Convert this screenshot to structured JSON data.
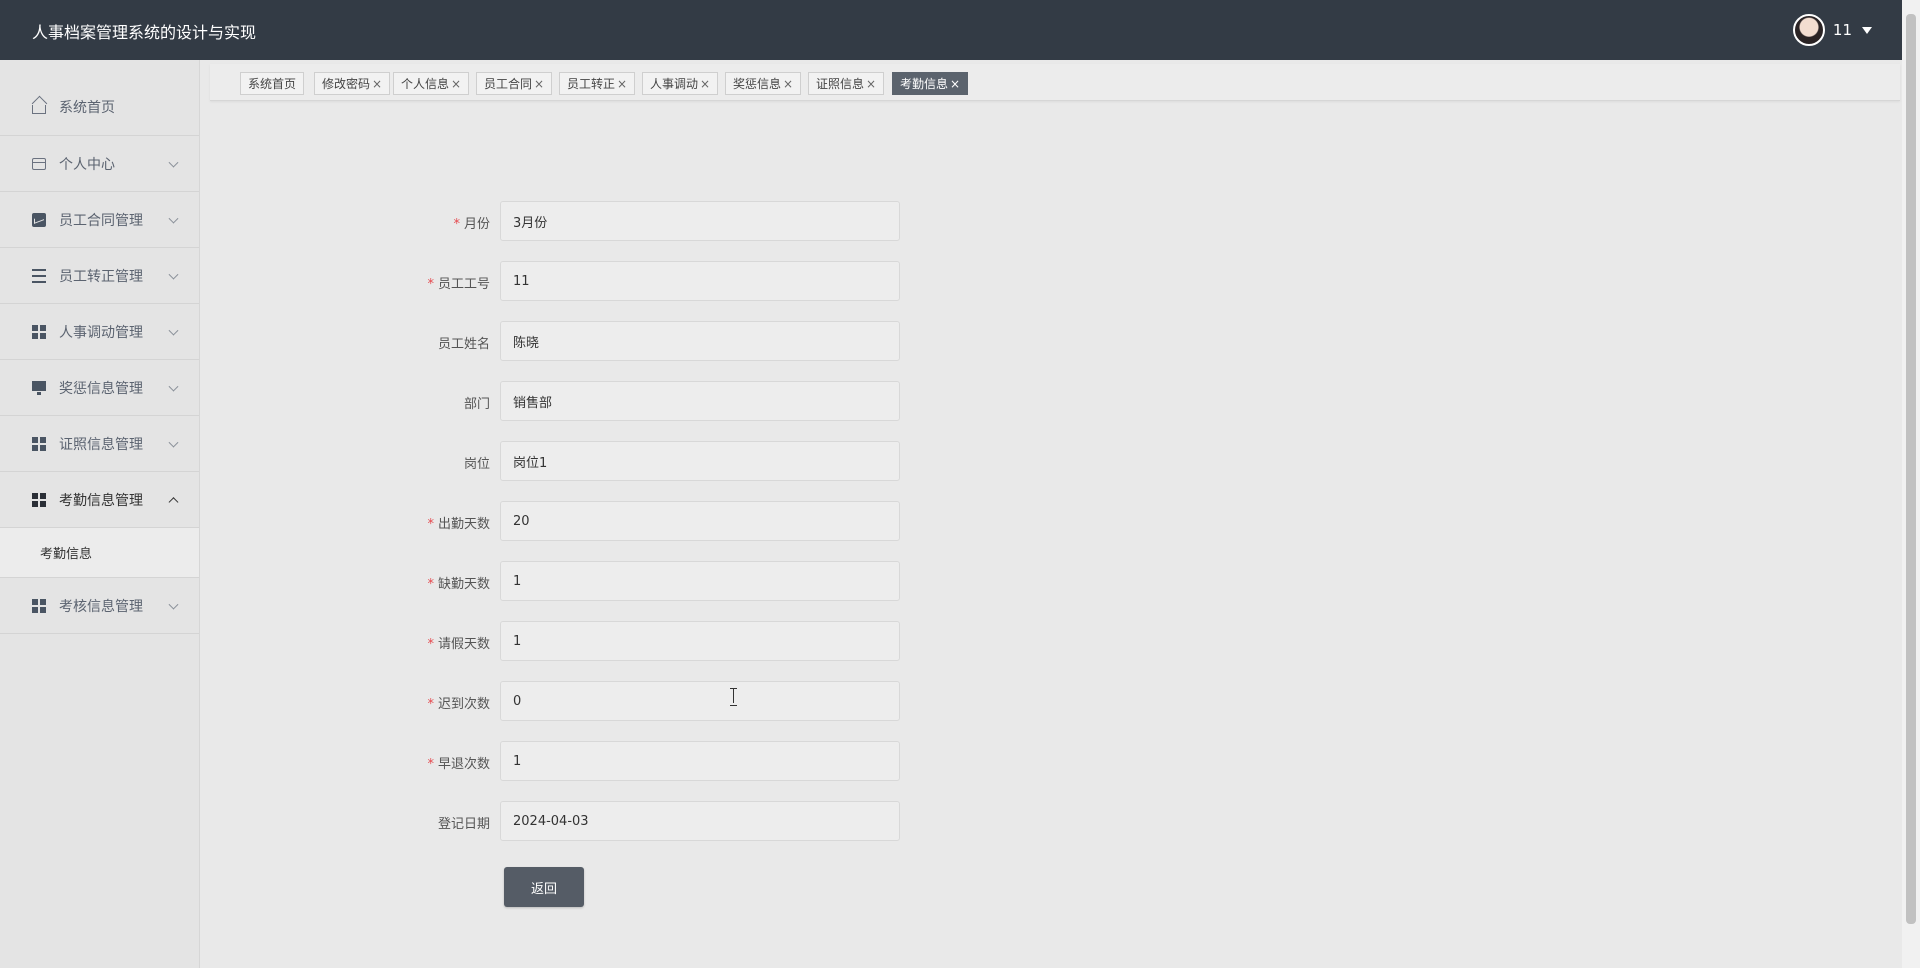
{
  "header": {
    "title": "人事档案管理系统的设计与实现",
    "username": "11"
  },
  "sidebar": {
    "items": [
      {
        "label": "系统首页",
        "icon": "home-icon"
      },
      {
        "label": "个人中心",
        "icon": "card-icon"
      },
      {
        "label": "员工合同管理",
        "icon": "chart-icon"
      },
      {
        "label": "员工转正管理",
        "icon": "list-icon"
      },
      {
        "label": "人事调动管理",
        "icon": "grid-icon"
      },
      {
        "label": "奖惩信息管理",
        "icon": "monitor-icon"
      },
      {
        "label": "证照信息管理",
        "icon": "grid-icon"
      },
      {
        "label": "考勤信息管理",
        "icon": "grid-icon",
        "expanded": true,
        "sub": "考勤信息"
      },
      {
        "label": "考核信息管理",
        "icon": "grid-icon"
      }
    ]
  },
  "tabs": [
    {
      "label": "系统首页",
      "closable": false
    },
    {
      "label": "修改密码",
      "closable": true
    },
    {
      "label": "个人信息",
      "closable": true
    },
    {
      "label": "员工合同",
      "closable": true
    },
    {
      "label": "员工转正",
      "closable": true
    },
    {
      "label": "人事调动",
      "closable": true
    },
    {
      "label": "奖惩信息",
      "closable": true
    },
    {
      "label": "证照信息",
      "closable": true
    },
    {
      "label": "考勤信息",
      "closable": true,
      "active": true
    }
  ],
  "tab_close_glyph": "×",
  "required_mark": "*",
  "form": {
    "fields": [
      {
        "label": "月份",
        "value": "3月份",
        "required": true
      },
      {
        "label": "员工工号",
        "value": "11",
        "required": true
      },
      {
        "label": "员工姓名",
        "value": "陈晓",
        "required": false
      },
      {
        "label": "部门",
        "value": "销售部",
        "required": false
      },
      {
        "label": "岗位",
        "value": "岗位1",
        "required": false
      },
      {
        "label": "出勤天数",
        "value": "20",
        "required": true
      },
      {
        "label": "缺勤天数",
        "value": "1",
        "required": true
      },
      {
        "label": "请假天数",
        "value": "1",
        "required": true
      },
      {
        "label": "迟到次数",
        "value": "0",
        "required": true
      },
      {
        "label": "早退次数",
        "value": "1",
        "required": true
      },
      {
        "label": "登记日期",
        "value": "2024-04-03",
        "required": false
      }
    ],
    "back_label": "返回"
  },
  "colors": {
    "header_bg": "#333b45",
    "active_tab": "#5b636d",
    "button_bg": "#555c66",
    "required": "#e5484d"
  }
}
